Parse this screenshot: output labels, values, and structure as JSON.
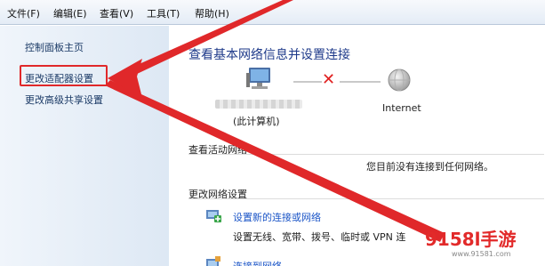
{
  "menubar": {
    "items": [
      "文件(F)",
      "编辑(E)",
      "查看(V)",
      "工具(T)",
      "帮助(H)"
    ]
  },
  "sidebar": {
    "items": [
      {
        "label": "控制面板主页"
      },
      {
        "label": "更改适配器设置"
      },
      {
        "label": "更改高级共享设置"
      }
    ]
  },
  "main": {
    "title": "查看基本网络信息并设置连接",
    "map": {
      "computer_label": "(此计算机)",
      "internet_label": "Internet"
    },
    "active_networks": {
      "title": "查看活动网络",
      "status": "您目前没有连接到任何网络。"
    },
    "change_settings": {
      "title": "更改网络设置",
      "tasks": [
        {
          "link": "设置新的连接或网络",
          "desc": "设置无线、宽带、拨号、临时或 VPN 连"
        },
        {
          "link": "连接到网络"
        }
      ]
    }
  },
  "watermark": {
    "logo": "9158l手游",
    "url": "www.91581.com"
  },
  "colors": {
    "accent_red": "#e0282a",
    "link_blue": "#1b55c7",
    "title_blue": "#1e3a8a"
  }
}
